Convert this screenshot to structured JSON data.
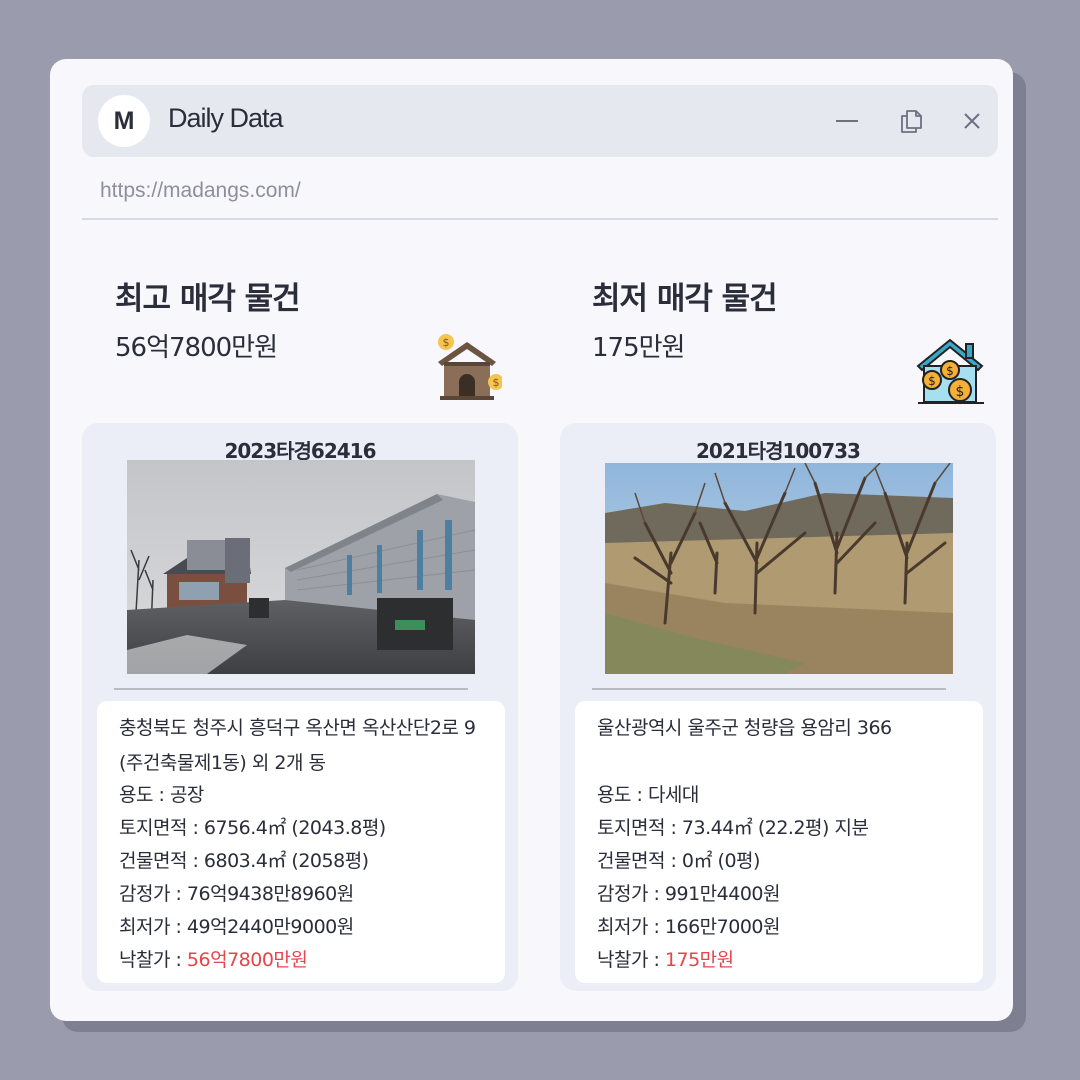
{
  "app": {
    "logo_letter": "M",
    "title": "Daily Data",
    "url": "https://madangs.com/"
  },
  "colors": {
    "accent_red": "#e5454b",
    "background": "#9a9cae",
    "window": "#f7f7fc"
  },
  "icons": [
    "minimize-icon",
    "copy-icon",
    "close-icon",
    "house-money-icon",
    "house-coins-icon"
  ],
  "highest": {
    "title": "최고 매각 물건",
    "price": "56억7800만원",
    "case_no": "2023타경62416",
    "address": "충청북도 청주시 흥덕구 옥산면 옥산산단2로 9 (주건축물제1동) 외 2개 동",
    "use": "용도 : 공장",
    "land_area": "토지면적 : 6756.4㎡ (2043.8평)",
    "building_area": "건물면적 : 6803.4㎡ (2058평)",
    "appraisal": "감정가 : 76억9438만8960원",
    "minimum": "최저가 : 49억2440만9000원",
    "winning_label": "낙찰가 : ",
    "winning_value": "56억7800만원"
  },
  "lowest": {
    "title": "최저 매각 물건",
    "price": "175만원",
    "case_no": "2021타경100733",
    "address": "울산광역시 울주군 청량읍 용암리 366",
    "use": "용도 : 다세대",
    "land_area": "토지면적 : 73.44㎡ (22.2평) 지분",
    "building_area": "건물면적 : 0㎡ (0평)",
    "appraisal": "감정가 : 991만4400원",
    "minimum": "최저가 : 166만7000원",
    "winning_label": "낙찰가 : ",
    "winning_value": "175만원"
  }
}
